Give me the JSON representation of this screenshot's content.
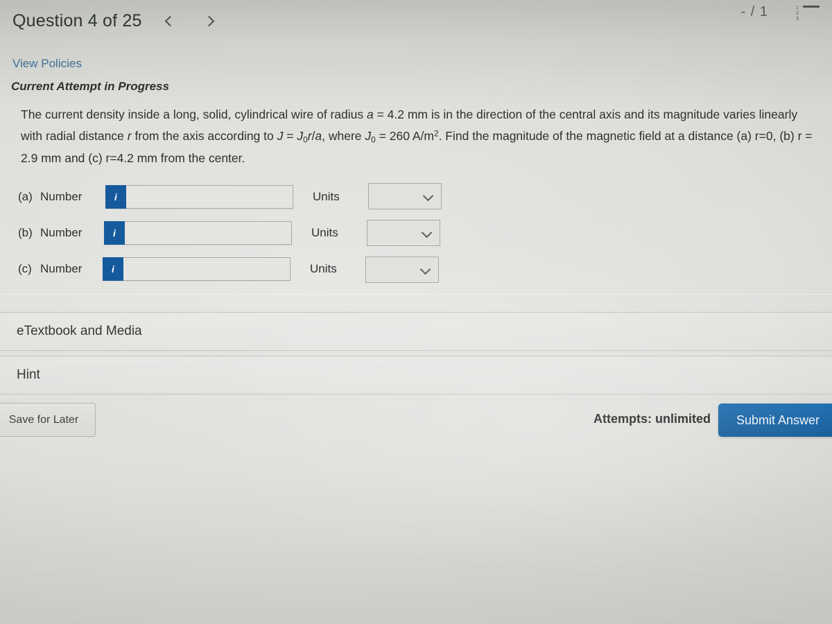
{
  "header": {
    "question_title": "Question 4 of 25",
    "prev_icon": "chevron-left-icon",
    "next_icon": "chevron-right-icon",
    "score": "- / 1",
    "menu_icon": "numbered-list-icon",
    "menu_numbers": [
      "1",
      "2",
      "3"
    ]
  },
  "links": {
    "view_policies": "View Policies"
  },
  "status": {
    "attempt_status": "Current Attempt in Progress"
  },
  "question": {
    "line1_a": "The current density inside a long, solid, cylindrical wire of radius ",
    "var_a": "a",
    "line1_b": " = 4.2 mm is in the direction of the central axis and its magnitude",
    "line2_a": "varies linearly with radial distance ",
    "var_r": "r",
    "line2_b": " from the axis according to ",
    "var_J": "J",
    "line2_c": " = ",
    "var_J0": "J",
    "sub_0": "0",
    "var_r2": "r",
    "line2_d": "/",
    "var_a2": "a",
    "line2_e": ", where ",
    "var_J0b": "J",
    "sub_0b": "0",
    "line2_f": " = 260 A/m",
    "sup_2": "2",
    "line2_g": ". Find the magnitude of the magnetic",
    "line3": "field at a distance (a) r=0, (b) r = 2.9 mm and (c) r=4.2 mm from the center."
  },
  "answers": {
    "units_label": "Units",
    "info_icon": "info-icon",
    "info_glyph": "i",
    "dropdown_icon": "chevron-down-icon",
    "rows": [
      {
        "label": "(a)",
        "number_label": "Number",
        "value": "",
        "placeholder": "",
        "unit_value": ""
      },
      {
        "label": "(b)",
        "number_label": "Number",
        "value": "",
        "placeholder": "",
        "unit_value": ""
      },
      {
        "label": "(c)",
        "number_label": "Number",
        "value": "",
        "placeholder": "",
        "unit_value": ""
      }
    ]
  },
  "sections": {
    "etextbook": "eTextbook and Media",
    "hint": "Hint"
  },
  "footer": {
    "save_label": "Save for Later",
    "attempts": "Attempts: unlimited",
    "submit_label": "Submit Answer"
  },
  "colors": {
    "accent_blue": "#13599d",
    "submit_blue": "#1a6cb0",
    "link_blue": "#3f6f96",
    "page_bg": "#d5d6d2",
    "text": "#2c302d"
  }
}
